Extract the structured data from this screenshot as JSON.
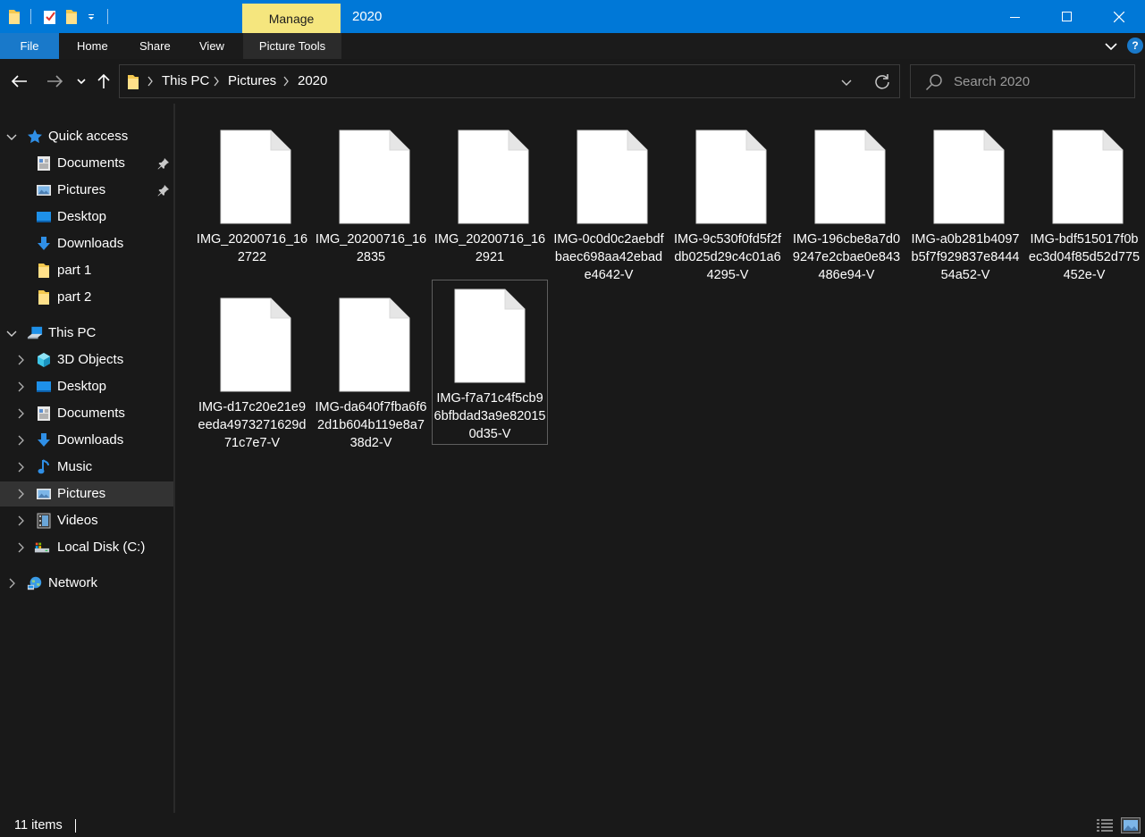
{
  "window": {
    "title": "2020",
    "contextual_tab": "Manage",
    "accent_color": "#0078d7"
  },
  "ribbon": {
    "tabs": [
      "File",
      "Home",
      "Share",
      "View",
      "Picture Tools"
    ]
  },
  "navigation": {
    "breadcrumb": [
      "This PC",
      "Pictures",
      "2020"
    ],
    "search_placeholder": "Search 2020"
  },
  "sidebar": {
    "quick_access": {
      "label": "Quick access",
      "items": [
        {
          "label": "Documents",
          "icon": "documents-icon",
          "pinned": true
        },
        {
          "label": "Pictures",
          "icon": "pictures-icon",
          "pinned": true
        },
        {
          "label": "Desktop",
          "icon": "desktop-icon",
          "pinned": false
        },
        {
          "label": "Downloads",
          "icon": "downloads-icon",
          "pinned": false
        },
        {
          "label": "part 1",
          "icon": "folder-icon",
          "pinned": false
        },
        {
          "label": "part 2",
          "icon": "folder-icon",
          "pinned": false
        }
      ]
    },
    "this_pc": {
      "label": "This PC",
      "items": [
        {
          "label": "3D Objects",
          "icon": "3d-objects-icon"
        },
        {
          "label": "Desktop",
          "icon": "desktop-icon"
        },
        {
          "label": "Documents",
          "icon": "documents-icon"
        },
        {
          "label": "Downloads",
          "icon": "downloads-icon"
        },
        {
          "label": "Music",
          "icon": "music-icon"
        },
        {
          "label": "Pictures",
          "icon": "pictures-icon",
          "selected": true
        },
        {
          "label": "Videos",
          "icon": "videos-icon"
        },
        {
          "label": "Local Disk (C:)",
          "icon": "local-disk-icon"
        }
      ]
    },
    "network": {
      "label": "Network",
      "icon": "network-icon"
    }
  },
  "files": [
    {
      "name": "IMG_20200716_162722"
    },
    {
      "name": "IMG_20200716_162835"
    },
    {
      "name": "IMG_20200716_162921"
    },
    {
      "name": "IMG-0c0d0c2aebdfbaec698aa42ebade4642-V"
    },
    {
      "name": "IMG-9c530f0fd5f2fdb025d29c4c01a64295-V"
    },
    {
      "name": "IMG-196cbe8a7d09247e2cbae0e843486e94-V"
    },
    {
      "name": "IMG-a0b281b4097b5f7f929837e844454a52-V"
    },
    {
      "name": "IMG-bdf515017f0bec3d04f85d52d775452e-V"
    },
    {
      "name": "IMG-d17c20e21e9eeda4973271629d71c7e7-V"
    },
    {
      "name": "IMG-da640f7fba6f62d1b604b119e8a738d2-V"
    },
    {
      "name": "IMG-f7a71c4f5cb96bfbdad3a9e820150d35-V",
      "focused": true
    }
  ],
  "status": {
    "item_count": "11 items"
  }
}
